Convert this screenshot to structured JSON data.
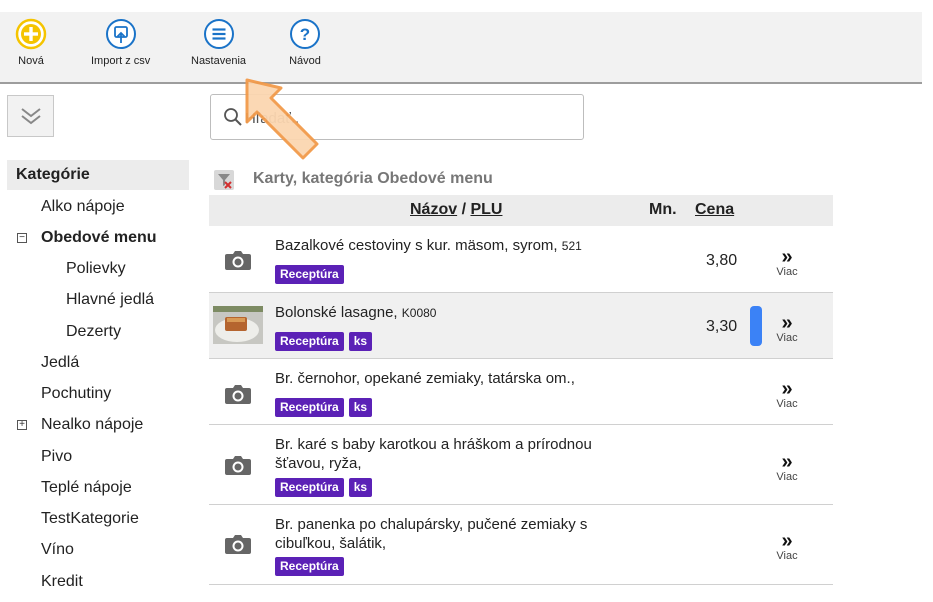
{
  "toolbar": {
    "new_label": "Nová",
    "import_label": "Import z csv",
    "settings_label": "Nastavenia",
    "help_label": "Návod",
    "icon_plus": "+",
    "icon_help": "?"
  },
  "search": {
    "placeholder": "Hľadať.."
  },
  "sidebar": {
    "header": "Kategórie",
    "toggle_collapse": "⊟",
    "toggle_expand": "⊞",
    "items": [
      {
        "label": "Alko nápoje"
      },
      {
        "label": "Obedové menu"
      },
      {
        "label": "Polievky"
      },
      {
        "label": "Hlavné jedlá"
      },
      {
        "label": "Dezerty"
      },
      {
        "label": "Jedlá"
      },
      {
        "label": "Pochutiny"
      },
      {
        "label": "Nealko nápoje"
      },
      {
        "label": "Pivo"
      },
      {
        "label": "Teplé nápoje"
      },
      {
        "label": "TestKategorie"
      },
      {
        "label": "Víno"
      },
      {
        "label": "Kredit"
      }
    ]
  },
  "list": {
    "filter_title": "Karty, kategória Obedové menu",
    "columns": {
      "name": "Názov",
      "separator": " / ",
      "plu": "PLU",
      "qty": "Mn.",
      "price": "Cena"
    },
    "rows": [
      {
        "name": "Bazalkové cestoviny s kur. mäsom, syrom, ",
        "plu": "521",
        "price": "3,80",
        "tags": [
          "Receptúra"
        ],
        "more_arrow": "»",
        "more_label": "Viac"
      },
      {
        "name": "Bolonské lasagne, ",
        "plu": "K0080",
        "price": "3,30",
        "tags": [
          "Receptúra",
          "ks"
        ],
        "more_arrow": "»",
        "more_label": "Viac"
      },
      {
        "name": "Br. černohor, opekané zemiaky, tatárska om.,",
        "plu": "",
        "price": "",
        "tags": [
          "Receptúra",
          "ks"
        ],
        "more_arrow": "»",
        "more_label": "Viac"
      },
      {
        "name": "Br. karé s baby karotkou a hráškom a prírodnou šťavou, ryža,",
        "plu": "",
        "price": "",
        "tags": [
          "Receptúra",
          "ks"
        ],
        "more_arrow": "»",
        "more_label": "Viac"
      },
      {
        "name": "Br. panenka po chalupársky, pučené zemiaky s cibuľkou, šalátik,",
        "plu": "",
        "price": "",
        "tags": [
          "Receptúra"
        ],
        "more_arrow": "»",
        "more_label": "Viac"
      }
    ]
  },
  "colors": {
    "tag_bg": "#5b21b6",
    "new_icon": "#f5c400",
    "toolbar_icons": "#1a73c8",
    "qty_bar": "#3b82f6"
  }
}
